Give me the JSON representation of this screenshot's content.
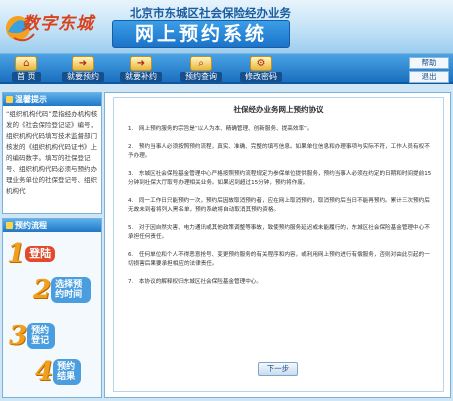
{
  "header": {
    "logo_text": "数字东城",
    "subtitle": "北京市东城区社会保险经办业务",
    "title": "网上预约系统"
  },
  "nav": {
    "items": [
      {
        "label": "首 页",
        "icon": "home-icon"
      },
      {
        "label": "就要预约",
        "icon": "arrow-icon"
      },
      {
        "label": "就要补约",
        "icon": "arrow-icon"
      },
      {
        "label": "预约查询",
        "icon": "search-icon"
      },
      {
        "label": "修改密码",
        "icon": "gear-icon"
      }
    ],
    "side_links": [
      "帮助",
      "退出"
    ]
  },
  "tips": {
    "title": "温馨提示",
    "body": "“组织机构代码”是指经办机构核发的《社会保险登记证》编号，组织机构代码填写技术监督部门核发的《组织机构代码证书》上的编码数字。填写的社保登记号、组织机构代码必须与预约办理业务单位的社保登记号、组织机构代"
  },
  "flow": {
    "title": "预约流程",
    "steps": [
      {
        "num": "1",
        "label": "登陆"
      },
      {
        "num": "2",
        "label": "选择预约时间"
      },
      {
        "num": "3",
        "label": "预约登记"
      },
      {
        "num": "4",
        "label": "预约结果"
      }
    ]
  },
  "agreement": {
    "title": "社保经办业务网上预约协议",
    "clauses": [
      "1.　网上预约服务的宗旨是“以人为本、精确管理、创新服务、提高效率”。",
      "2.　预约当事人必须按照预约流程，真实、准确、完整的填写信息。如果单位信息和办理事项与实际不符，工作人员有权不予办理。",
      "3.　东城区社会保险基金管理中心严格按照预约流程规定为参保单位提供服务，预约当事人必须在约定的日期和时间提前15分钟到社保大厅取号办理相关业务。如果迟到超过15分钟，预约将作废。",
      "4.　同一工作日只能预约一次，预约后因故取消预约者，应在网上取消预约，取消预约后当日不能再预约。累计三次预约后无故未到者将列入黑名单，预约系统将自动取消其预约资格。",
      "5.　对于因自然灾害、电力通讯或其他政策调整等事故，致使预约服务延迟或未能履行的，东城区社会保险基金管理中心不承担任何责任。",
      "6.　任何单位和个人不得恶意抢号、变更预约服务的有关程序和内容，或利用网上预约进行有偿服务，否则对由此引起的一切损害后果要承担相应的法律责任。",
      "7.　本协议的解释权归东城区社会保险基金管理中心。"
    ],
    "next_label": "下一步"
  }
}
